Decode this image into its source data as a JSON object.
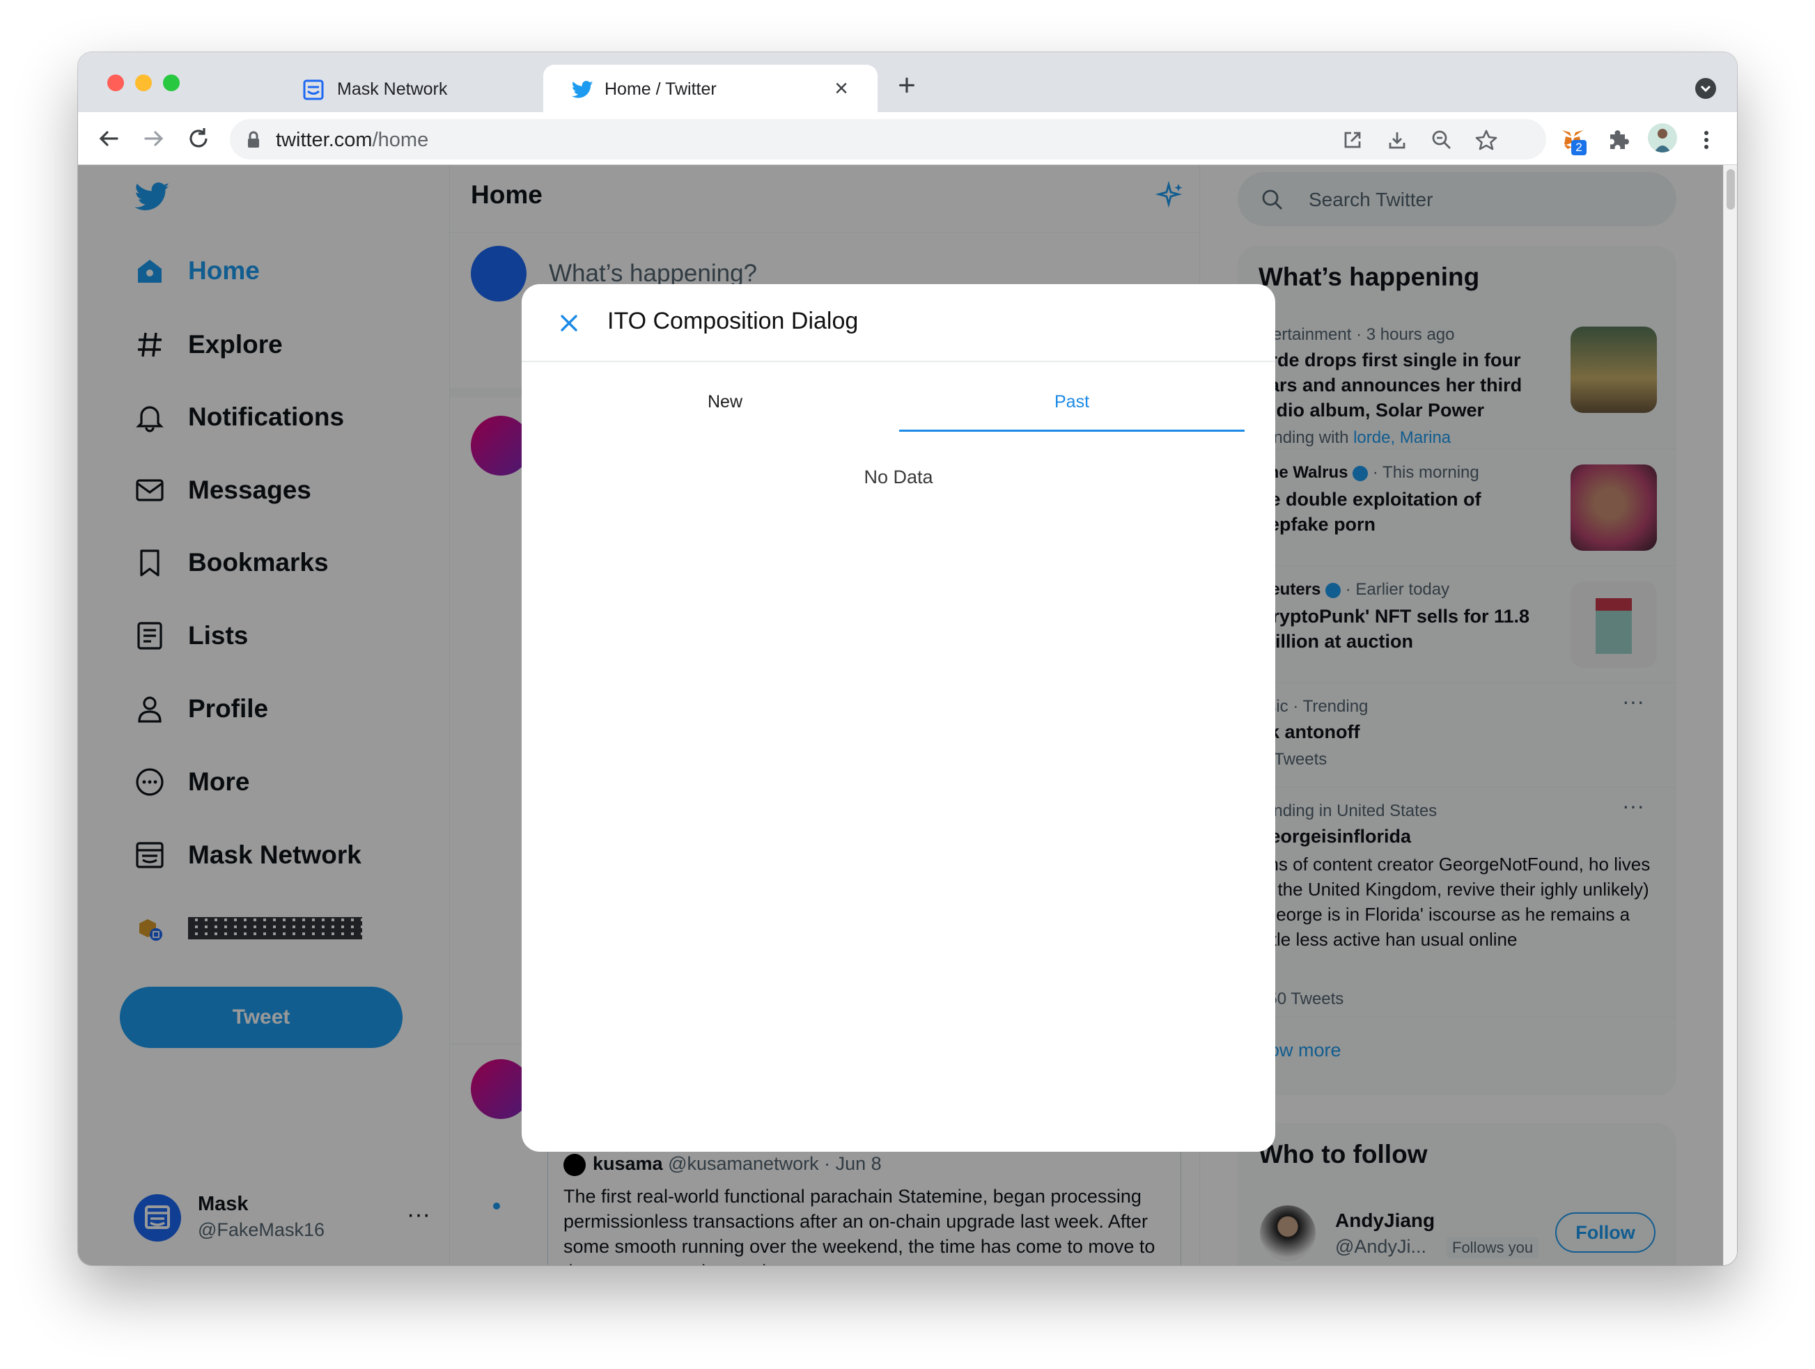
{
  "browser": {
    "tabs": [
      {
        "title": "Mask Network",
        "active": false
      },
      {
        "title": "Home / Twitter",
        "active": true
      }
    ],
    "url_host": "twitter.com",
    "url_path": "/home",
    "extension_badge": "2"
  },
  "twitter": {
    "nav": [
      {
        "label": "Home",
        "icon": "home-icon"
      },
      {
        "label": "Explore",
        "icon": "hashtag-icon"
      },
      {
        "label": "Notifications",
        "icon": "bell-icon"
      },
      {
        "label": "Messages",
        "icon": "envelope-icon"
      },
      {
        "label": "Bookmarks",
        "icon": "bookmark-icon"
      },
      {
        "label": "Lists",
        "icon": "list-icon"
      },
      {
        "label": "Profile",
        "icon": "person-icon"
      },
      {
        "label": "More",
        "icon": "more-circle-icon"
      },
      {
        "label": "Mask Network",
        "icon": "mask-icon"
      }
    ],
    "tweet_button": "Tweet",
    "account": {
      "name": "Mask",
      "handle": "@FakeMask16"
    },
    "home_title": "Home",
    "composer_placeholder": "What’s happening?",
    "tweet": {
      "author": "kusama",
      "handle": "@kusamanetwork",
      "date": "· Jun 8",
      "text": "The first real-world functional parachain Statemine, began processing permissionless transactions after an on-chain upgrade last week. After some smooth running over the weekend, the time has come to move to the next stage: slot auctions."
    },
    "search_placeholder": "Search Twitter",
    "whats_happening": {
      "title": "What’s happening",
      "trends": [
        {
          "meta": "ntertainment · 3 hours ago",
          "title": "orde drops first single in four ears and announces her third tudio album, Solar Power",
          "sub_prefix": "rending with",
          "sub_links": "lorde, Marina"
        },
        {
          "meta_source": "The Walrus",
          "meta_time": "· This morning",
          "title": "he double exploitation of eepfake porn"
        },
        {
          "meta_source": "Reuters",
          "meta_time": "· Earlier today",
          "title": "CryptoPunk' NFT sells for 11.8 million at auction"
        },
        {
          "meta": "usic · Trending",
          "title": "ck antonoff",
          "count": "K Tweets"
        },
        {
          "meta": "rending in United States",
          "title": "georgeisinflorida",
          "desc": "ans of content creator GeorgeNotFound, ho lives in the United Kingdom, revive their ighly unlikely) 'George is in Florida' iscourse as he remains a little less active han usual online",
          "count": "950 Tweets"
        }
      ],
      "show_more": "how more"
    },
    "who_to_follow": {
      "title": "Who to follow",
      "user": {
        "name": "AndyJiang",
        "handle": "@AndyJi...",
        "badge": "Follows you",
        "button": "Follow"
      }
    }
  },
  "dialog": {
    "title": "ITO Composition Dialog",
    "tabs": [
      {
        "label": "New",
        "selected": false
      },
      {
        "label": "Past",
        "selected": true
      }
    ],
    "empty_text": "No Data"
  },
  "colors": {
    "twitter_blue": "#1d9bf0",
    "dialog_accent": "#1c8ae6"
  }
}
